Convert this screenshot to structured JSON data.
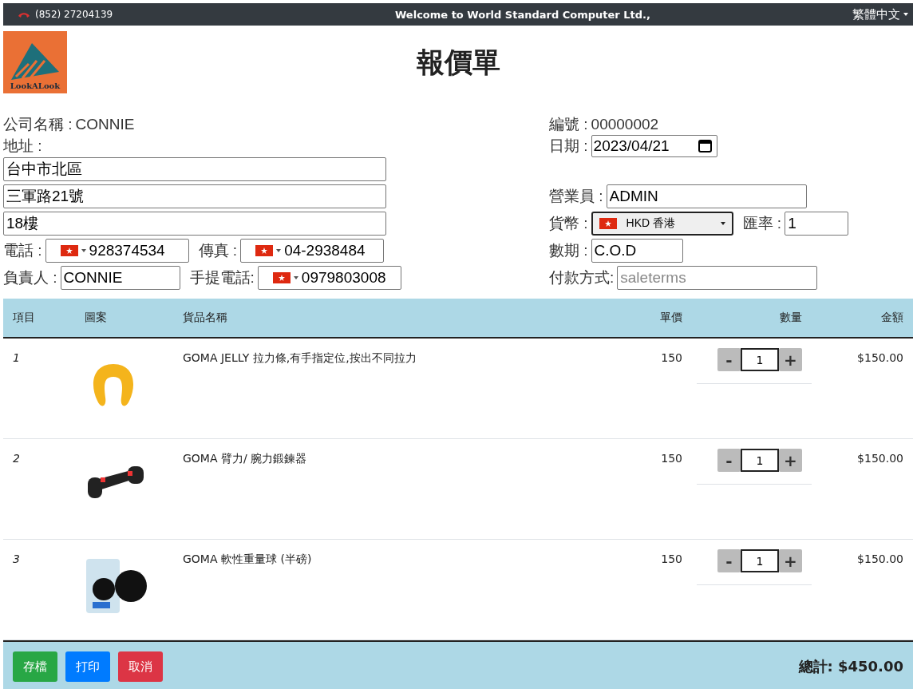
{
  "top_bar": {
    "phone": "(852) 27204139",
    "welcome": "Welcome to World Standard Computer Ltd.,",
    "language": "繁體中文"
  },
  "logo": {
    "text": "LookALook"
  },
  "title": "報價單",
  "customer": {
    "company_label": "公司名稱 :",
    "company": "CONNIE",
    "address_label": "地址 :",
    "address_lines": [
      "台中市北區",
      "三軍路21號",
      "18樓"
    ],
    "phone_label": "電話 :",
    "phone": "928374534",
    "fax_label": "傳真 :",
    "fax": "04-2938484",
    "contact_label": "負責人 :",
    "contact": "CONNIE",
    "mobile_label": "手提電話:",
    "mobile": "0979803008"
  },
  "quote": {
    "number_label": "編號 :",
    "number": "00000002",
    "date_label": "日期 :",
    "date": "2023/04/21",
    "salesman_label": "營業員 :",
    "salesman": "ADMIN",
    "currency_label": "貨幣 :",
    "currency": "HKD 香港",
    "rate_label": "匯率 :",
    "rate": "1",
    "terms_label": "數期 :",
    "terms": "C.O.D",
    "payment_label": "付款方式:",
    "payment_placeholder": "saleterms"
  },
  "table": {
    "columns": [
      "項目",
      "圖案",
      "貨品名稱",
      "單價",
      "數量",
      "金額"
    ],
    "rows": [
      {
        "item": "1",
        "name": "GOMA JELLY 拉力條,有手指定位,按出不同拉力",
        "price": "150",
        "minus": "-",
        "quantity": "1",
        "plus": "+",
        "amount": "$150.00"
      },
      {
        "item": "2",
        "name": "GOMA 臂力/ 腕力鍛鍊器",
        "price": "150",
        "minus": "-",
        "quantity": "1",
        "plus": "+",
        "amount": "$150.00"
      },
      {
        "item": "3",
        "name": "GOMA 軟性重量球 (半磅)",
        "price": "150",
        "minus": "-",
        "quantity": "1",
        "plus": "+",
        "amount": "$150.00"
      }
    ]
  },
  "footer": {
    "buttons": [
      {
        "label": "存檔",
        "kind": "success"
      },
      {
        "label": "打印",
        "kind": "primary"
      },
      {
        "label": "取消",
        "kind": "danger"
      }
    ],
    "total": "總計: $450.00"
  }
}
